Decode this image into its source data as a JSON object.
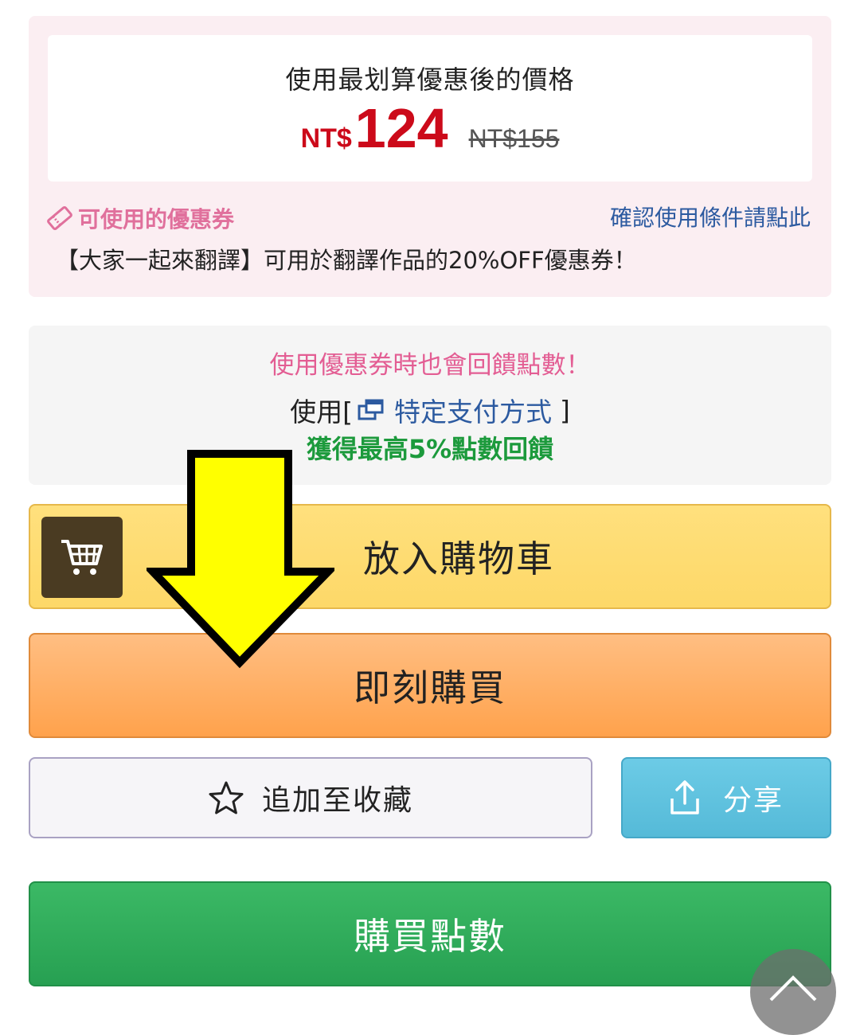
{
  "price_card": {
    "heading": "使用最划算優惠後的價格",
    "currency": "NT$",
    "discounted_price": "124",
    "original_price": "NT$155"
  },
  "coupon": {
    "label": "可使用的優惠券",
    "icon": "coupon-tag-icon",
    "conditions_link": "確認使用條件請點此",
    "description": "【大家一起來翻譯】可用於翻譯作品的20%OFF優惠券！"
  },
  "points_info": {
    "notice": "使用優惠券時也會回饋點數！",
    "prefix": "使用[",
    "payment_link": "特定支付方式",
    "suffix": "]",
    "reward": "獲得最高5%點數回饋"
  },
  "actions": {
    "add_to_cart": "放入購物車",
    "buy_now": "即刻購買",
    "add_favorite": "追加至收藏",
    "share": "分享",
    "buy_points": "購買點數"
  },
  "colors": {
    "price_red": "#cc0a1a",
    "coupon_pink": "#e0709c",
    "link_blue": "#2c5aa0",
    "reward_green": "#1c9a3c",
    "cart_yellow": "#fdd868",
    "buy_orange": "#ffa24c",
    "share_blue": "#55bad8",
    "points_green": "#27a052",
    "arrow_yellow": "#ffff00"
  }
}
